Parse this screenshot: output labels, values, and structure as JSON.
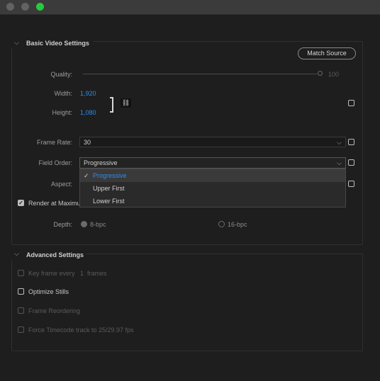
{
  "basic": {
    "title": "Basic Video Settings",
    "match_source": "Match Source",
    "quality_label": "Quality:",
    "quality_value": "100",
    "width_label": "Width:",
    "width_value": "1,920",
    "height_label": "Height:",
    "height_value": "1,080",
    "frame_rate_label": "Frame Rate:",
    "frame_rate_value": "30",
    "field_order_label": "Field Order:",
    "field_order_value": "Progressive",
    "aspect_label": "Aspect:",
    "render_max_label": "Render at Maximu",
    "depth_label": "Depth:",
    "depth_8": "8-bpc",
    "depth_16": "16-bpc"
  },
  "field_order_options": [
    "Progressive",
    "Upper First",
    "Lower First"
  ],
  "advanced": {
    "title": "Advanced Settings",
    "keyframe_label": "Key frame every",
    "keyframe_value": "1",
    "keyframe_unit": "frames",
    "optimize_stills": "Optimize Stills",
    "frame_reordering": "Frame Reordering",
    "force_timecode": "Force Timecode track to 25/29.97 fps"
  },
  "colors": {
    "accent": "#2d8ceb",
    "maximize": "#27c93f"
  }
}
